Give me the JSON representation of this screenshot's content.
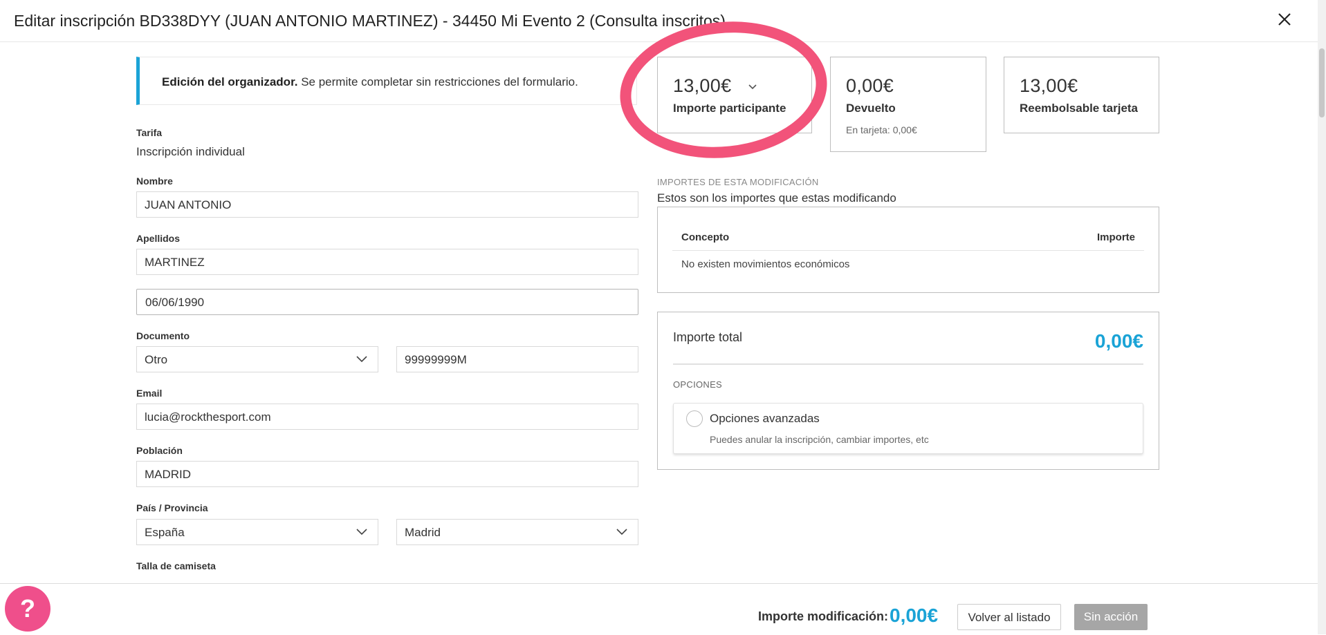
{
  "modal": {
    "title": "Editar inscripción BD338DYY (JUAN ANTONIO MARTINEZ) - 34450 Mi Evento 2 (Consulta inscritos)",
    "close_icon": "close-icon"
  },
  "notice": {
    "bold": "Edición del organizador.",
    "text": " Se permite completar sin restricciones del formulario.",
    "accent_color": "#1aa3d6"
  },
  "form": {
    "tarifa": {
      "label": "Tarifa",
      "value": "Inscripción individual"
    },
    "nombre": {
      "label": "Nombre",
      "value": "JUAN ANTONIO"
    },
    "apellidos": {
      "label": "Apellidos",
      "value": "MARTINEZ"
    },
    "fecha": {
      "value": "06/06/1990"
    },
    "documento": {
      "label": "Documento",
      "type": "Otro",
      "number": "99999999M"
    },
    "email": {
      "label": "Email",
      "value": "lucia@rockthesport.com"
    },
    "poblacion": {
      "label": "Población",
      "value": "MADRID"
    },
    "pais_provincia": {
      "label": "País / Provincia",
      "pais": "España",
      "provincia": "Madrid"
    },
    "talla": {
      "label": "Talla de camiseta"
    }
  },
  "summary": {
    "participante": {
      "amount": "13,00€",
      "label": "Importe participante"
    },
    "devuelto": {
      "amount": "0,00€",
      "label": "Devuelto",
      "sub": "En tarjeta: 0,00€"
    },
    "reembolsable": {
      "amount": "13,00€",
      "label": "Reembolsable tarjeta"
    },
    "highlight_color": "#f2537a"
  },
  "modificacion": {
    "caption": "IMPORTES DE ESTA MODIFICACIÓN",
    "description": "Estos son los importes que estas modificando",
    "col_concepto": "Concepto",
    "col_importe": "Importe",
    "empty": "No existen movimientos económicos"
  },
  "total": {
    "label": "Importe total",
    "value": "0,00€",
    "options_caption": "OPCIONES",
    "advanced_title": "Opciones avanzadas",
    "advanced_sub": "Puedes anular la inscripción, cambiar importes, etc",
    "value_color": "#1aa3d6"
  },
  "footer": {
    "help": "?",
    "label": "Importe modificación:",
    "value": "0,00€",
    "back_button": "Volver al listado",
    "none_button": "Sin acción",
    "help_color": "#ef4f8b"
  }
}
